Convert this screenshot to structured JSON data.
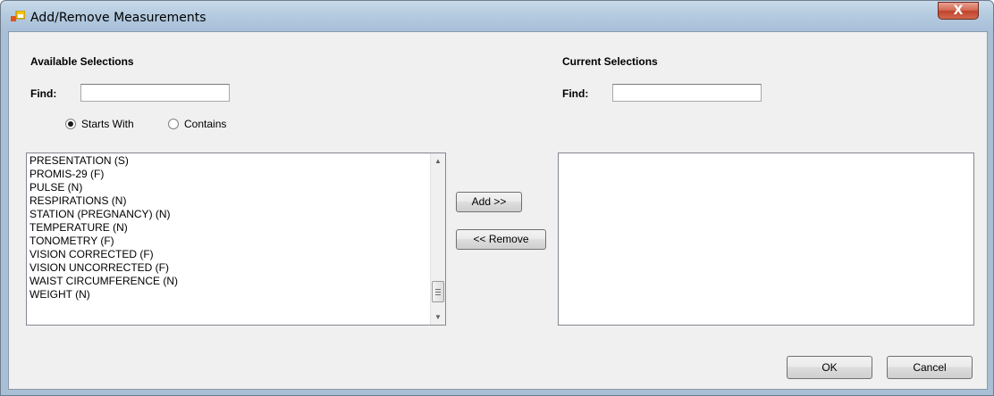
{
  "window": {
    "title": "Add/Remove Measurements",
    "close_glyph": "X"
  },
  "available": {
    "heading": "Available Selections",
    "find_label": "Find:",
    "find_value": "",
    "radio_starts_with": "Starts With",
    "radio_contains": "Contains",
    "selected_mode": "starts_with",
    "items": [
      "PRESENTATION (S)",
      "PROMIS-29 (F)",
      "PULSE (N)",
      "RESPIRATIONS (N)",
      "STATION (PREGNANCY) (N)",
      "TEMPERATURE (N)",
      "TONOMETRY (F)",
      "VISION CORRECTED (F)",
      "VISION UNCORRECTED (F)",
      "WAIST CIRCUMFERENCE (N)",
      "WEIGHT (N)"
    ]
  },
  "current": {
    "heading": "Current Selections",
    "find_label": "Find:",
    "find_value": "",
    "items": []
  },
  "buttons": {
    "add": "Add >>",
    "remove": "<< Remove",
    "ok": "OK",
    "cancel": "Cancel"
  },
  "icons": {
    "app": "add-remove-app-icon",
    "scroll_up": "scroll-up-arrow-icon",
    "scroll_down": "scroll-down-arrow-icon"
  }
}
